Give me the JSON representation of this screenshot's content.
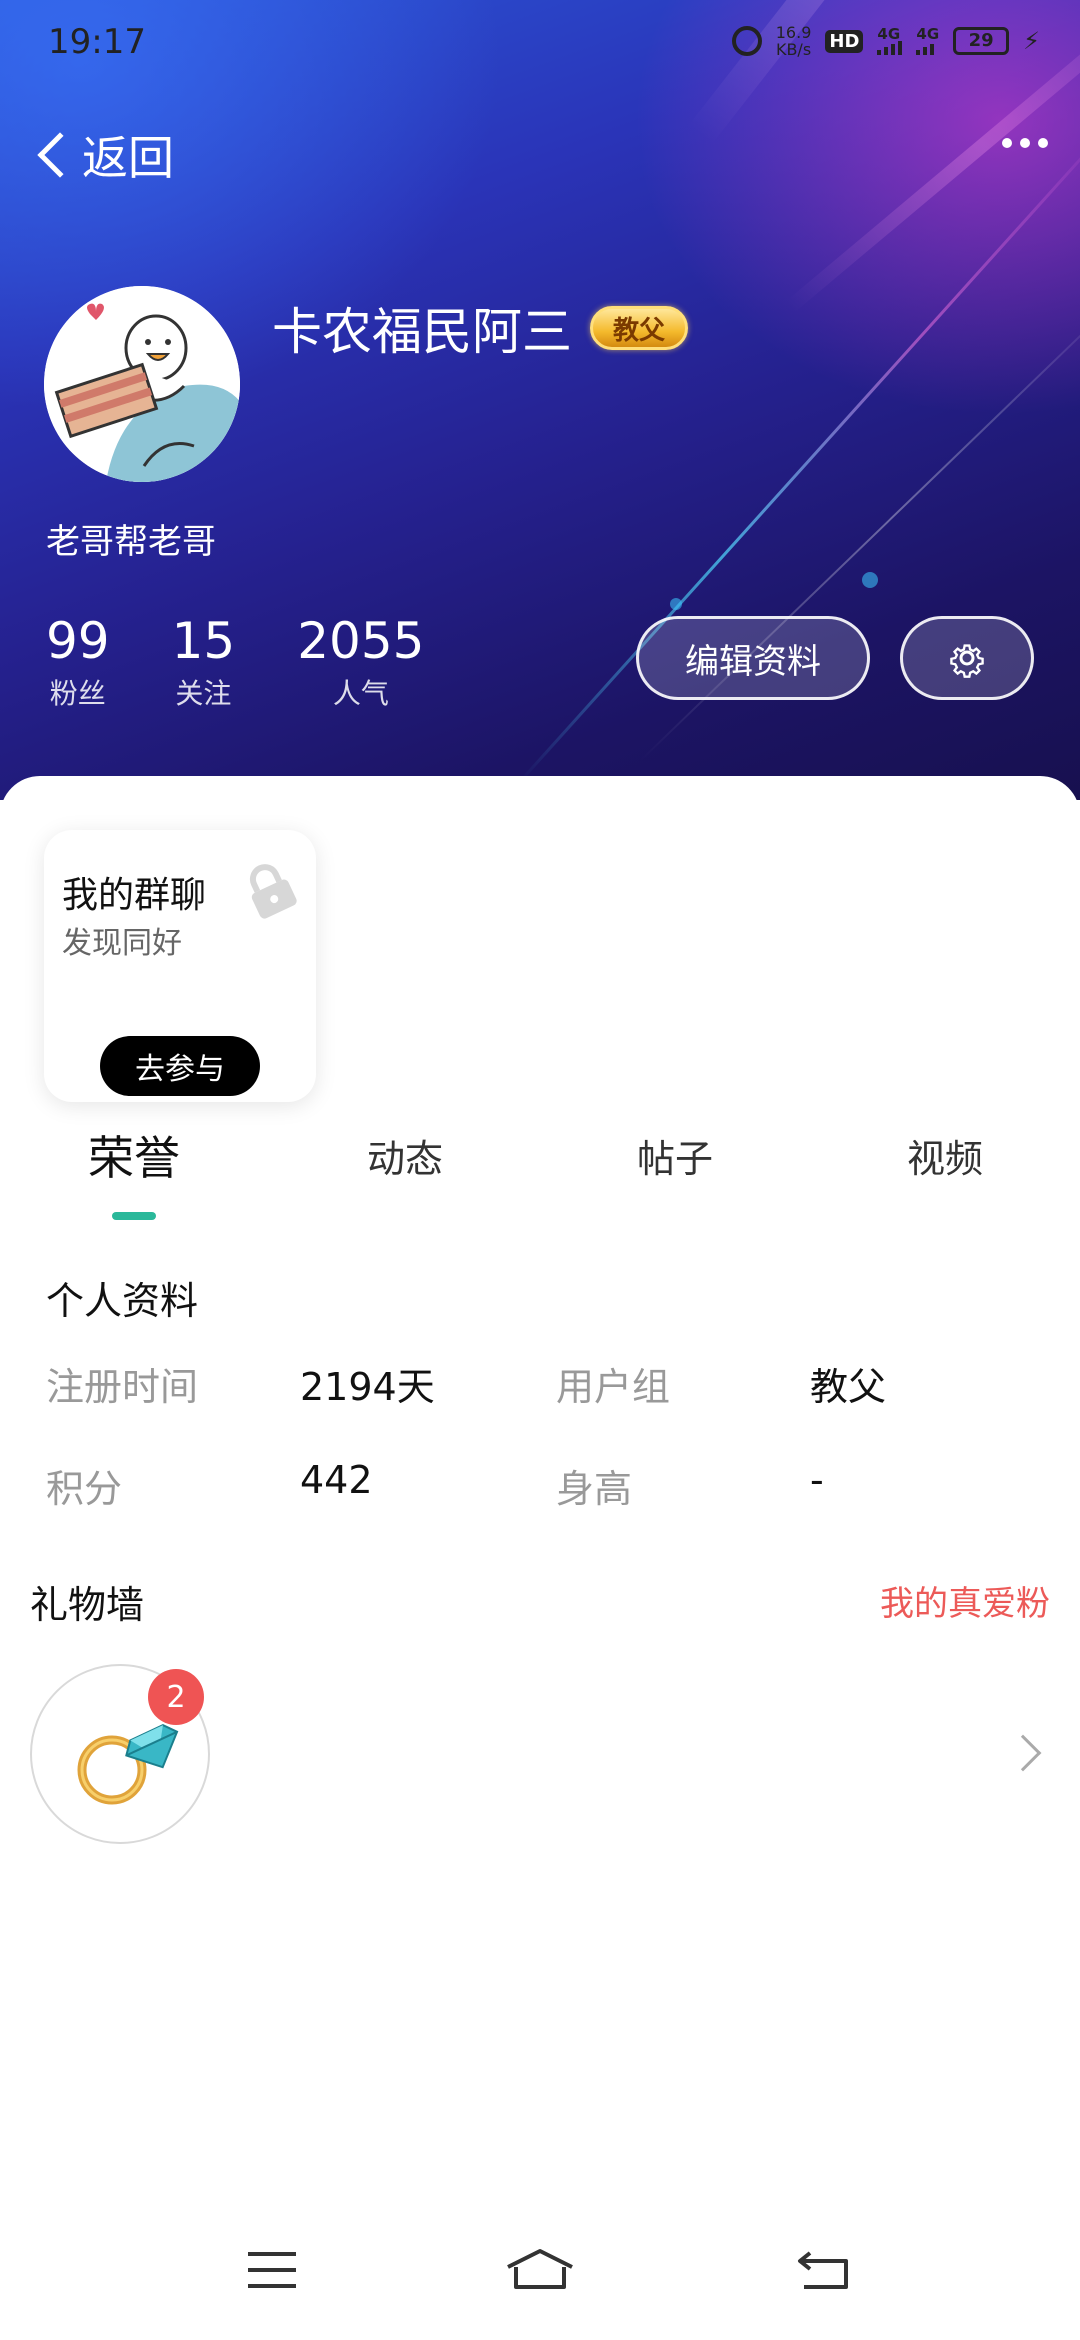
{
  "status_bar": {
    "time": "19:17",
    "net_speed_value": "16.9",
    "net_speed_unit": "KB/s",
    "hd_label": "HD",
    "sim1": "4G",
    "sim2": "4G",
    "battery": "29"
  },
  "nav": {
    "back_label": "返回"
  },
  "profile": {
    "username": "卡农福民阿三",
    "rank_badge": "教父",
    "bio": "老哥帮老哥",
    "stats": [
      {
        "value": "99",
        "label": "粉丝"
      },
      {
        "value": "15",
        "label": "关注"
      },
      {
        "value": "2055",
        "label": "人气"
      }
    ],
    "edit_button": "编辑资料"
  },
  "group_card": {
    "title": "我的群聊",
    "subtitle": "发现同好",
    "join_button": "去参与"
  },
  "tabs": [
    "荣誉",
    "动态",
    "帖子",
    "视频"
  ],
  "personal_info": {
    "title": "个人资料",
    "rows": [
      {
        "label1": "注册时间",
        "value1": "2194天",
        "label2": "用户组",
        "value2": "教父"
      },
      {
        "label1": "积分",
        "value1": "442",
        "label2": "身高",
        "value2": "-"
      }
    ]
  },
  "gift_wall": {
    "title": "礼物墙",
    "link": "我的真爱粉",
    "gift_count": "2"
  },
  "colors": {
    "accent_tab": "#2ab89a",
    "link_red": "#ec5a58",
    "badge_red": "#ef5454"
  }
}
